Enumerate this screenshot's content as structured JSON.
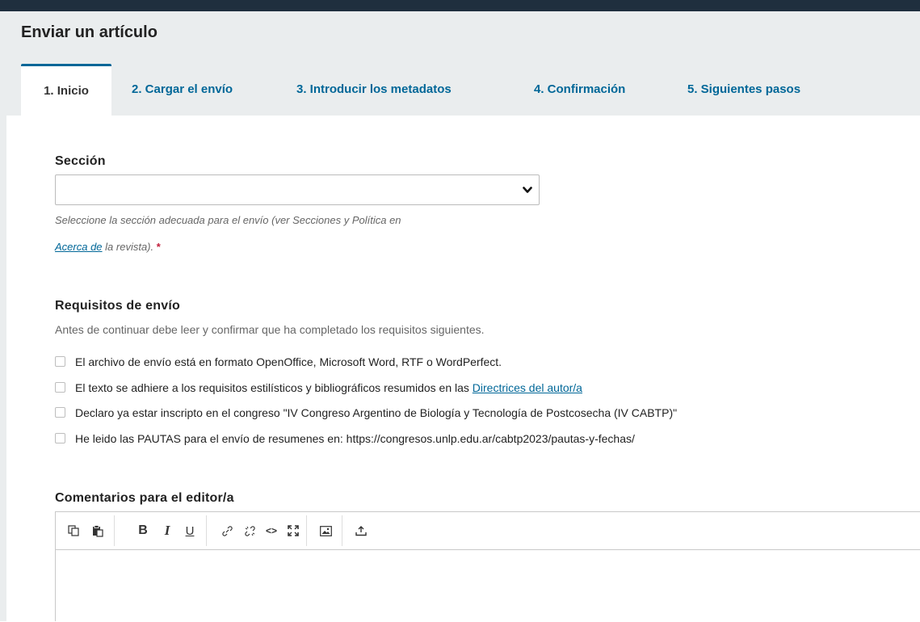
{
  "page": {
    "title": "Enviar un artículo"
  },
  "tabs": [
    {
      "label": "1. Inicio",
      "active": true
    },
    {
      "label": "2. Cargar el envío",
      "active": false
    },
    {
      "label": "3. Introducir los metadatos",
      "active": false
    },
    {
      "label": "4. Confirmación",
      "active": false
    },
    {
      "label": "5. Siguientes pasos",
      "active": false
    }
  ],
  "section": {
    "label": "Sección",
    "selected_value": "",
    "help_before": "Seleccione la sección adecuada para el envío (ver Secciones y Política en",
    "help_link": "Acerca de",
    "help_after": " la revista).",
    "required_mark": "*"
  },
  "requirements": {
    "heading": "Requisitos de envío",
    "description": "Antes de continuar debe leer y confirmar que ha completado los requisitos siguientes.",
    "items": [
      {
        "text": "El archivo de envío está en formato OpenOffice, Microsoft Word, RTF o WordPerfect.",
        "checked": false
      },
      {
        "text": "El texto se adhiere a los requisitos estilísticos y bibliográficos resumidos en las ",
        "link": "Directrices del autor/a",
        "checked": false
      },
      {
        "text": "Declaro ya estar inscripto en el congreso \"IV Congreso Argentino de Biología y Tecnología de Postcosecha (IV CABTP)\"",
        "checked": false
      },
      {
        "text": "He leido las PAUTAS para el envío de resumenes en: https://congresos.unlp.edu.ar/cabtp2023/pautas-y-fechas/",
        "checked": false
      }
    ]
  },
  "comments": {
    "label": "Comentarios para el editor/a",
    "toolbar": {
      "bold": "B",
      "italic": "I",
      "underline": "U",
      "code": "<>"
    },
    "icons": [
      "copy-icon",
      "paste-icon",
      "bold-icon",
      "italic-icon",
      "underline-icon",
      "link-icon",
      "unlink-icon",
      "code-icon",
      "fullscreen-icon",
      "image-icon",
      "upload-icon"
    ],
    "value": ""
  },
  "colors": {
    "accent": "#006798",
    "header_bg": "#1f2f3e",
    "required": "#c21f3c",
    "panel_bg": "#eaedee"
  }
}
